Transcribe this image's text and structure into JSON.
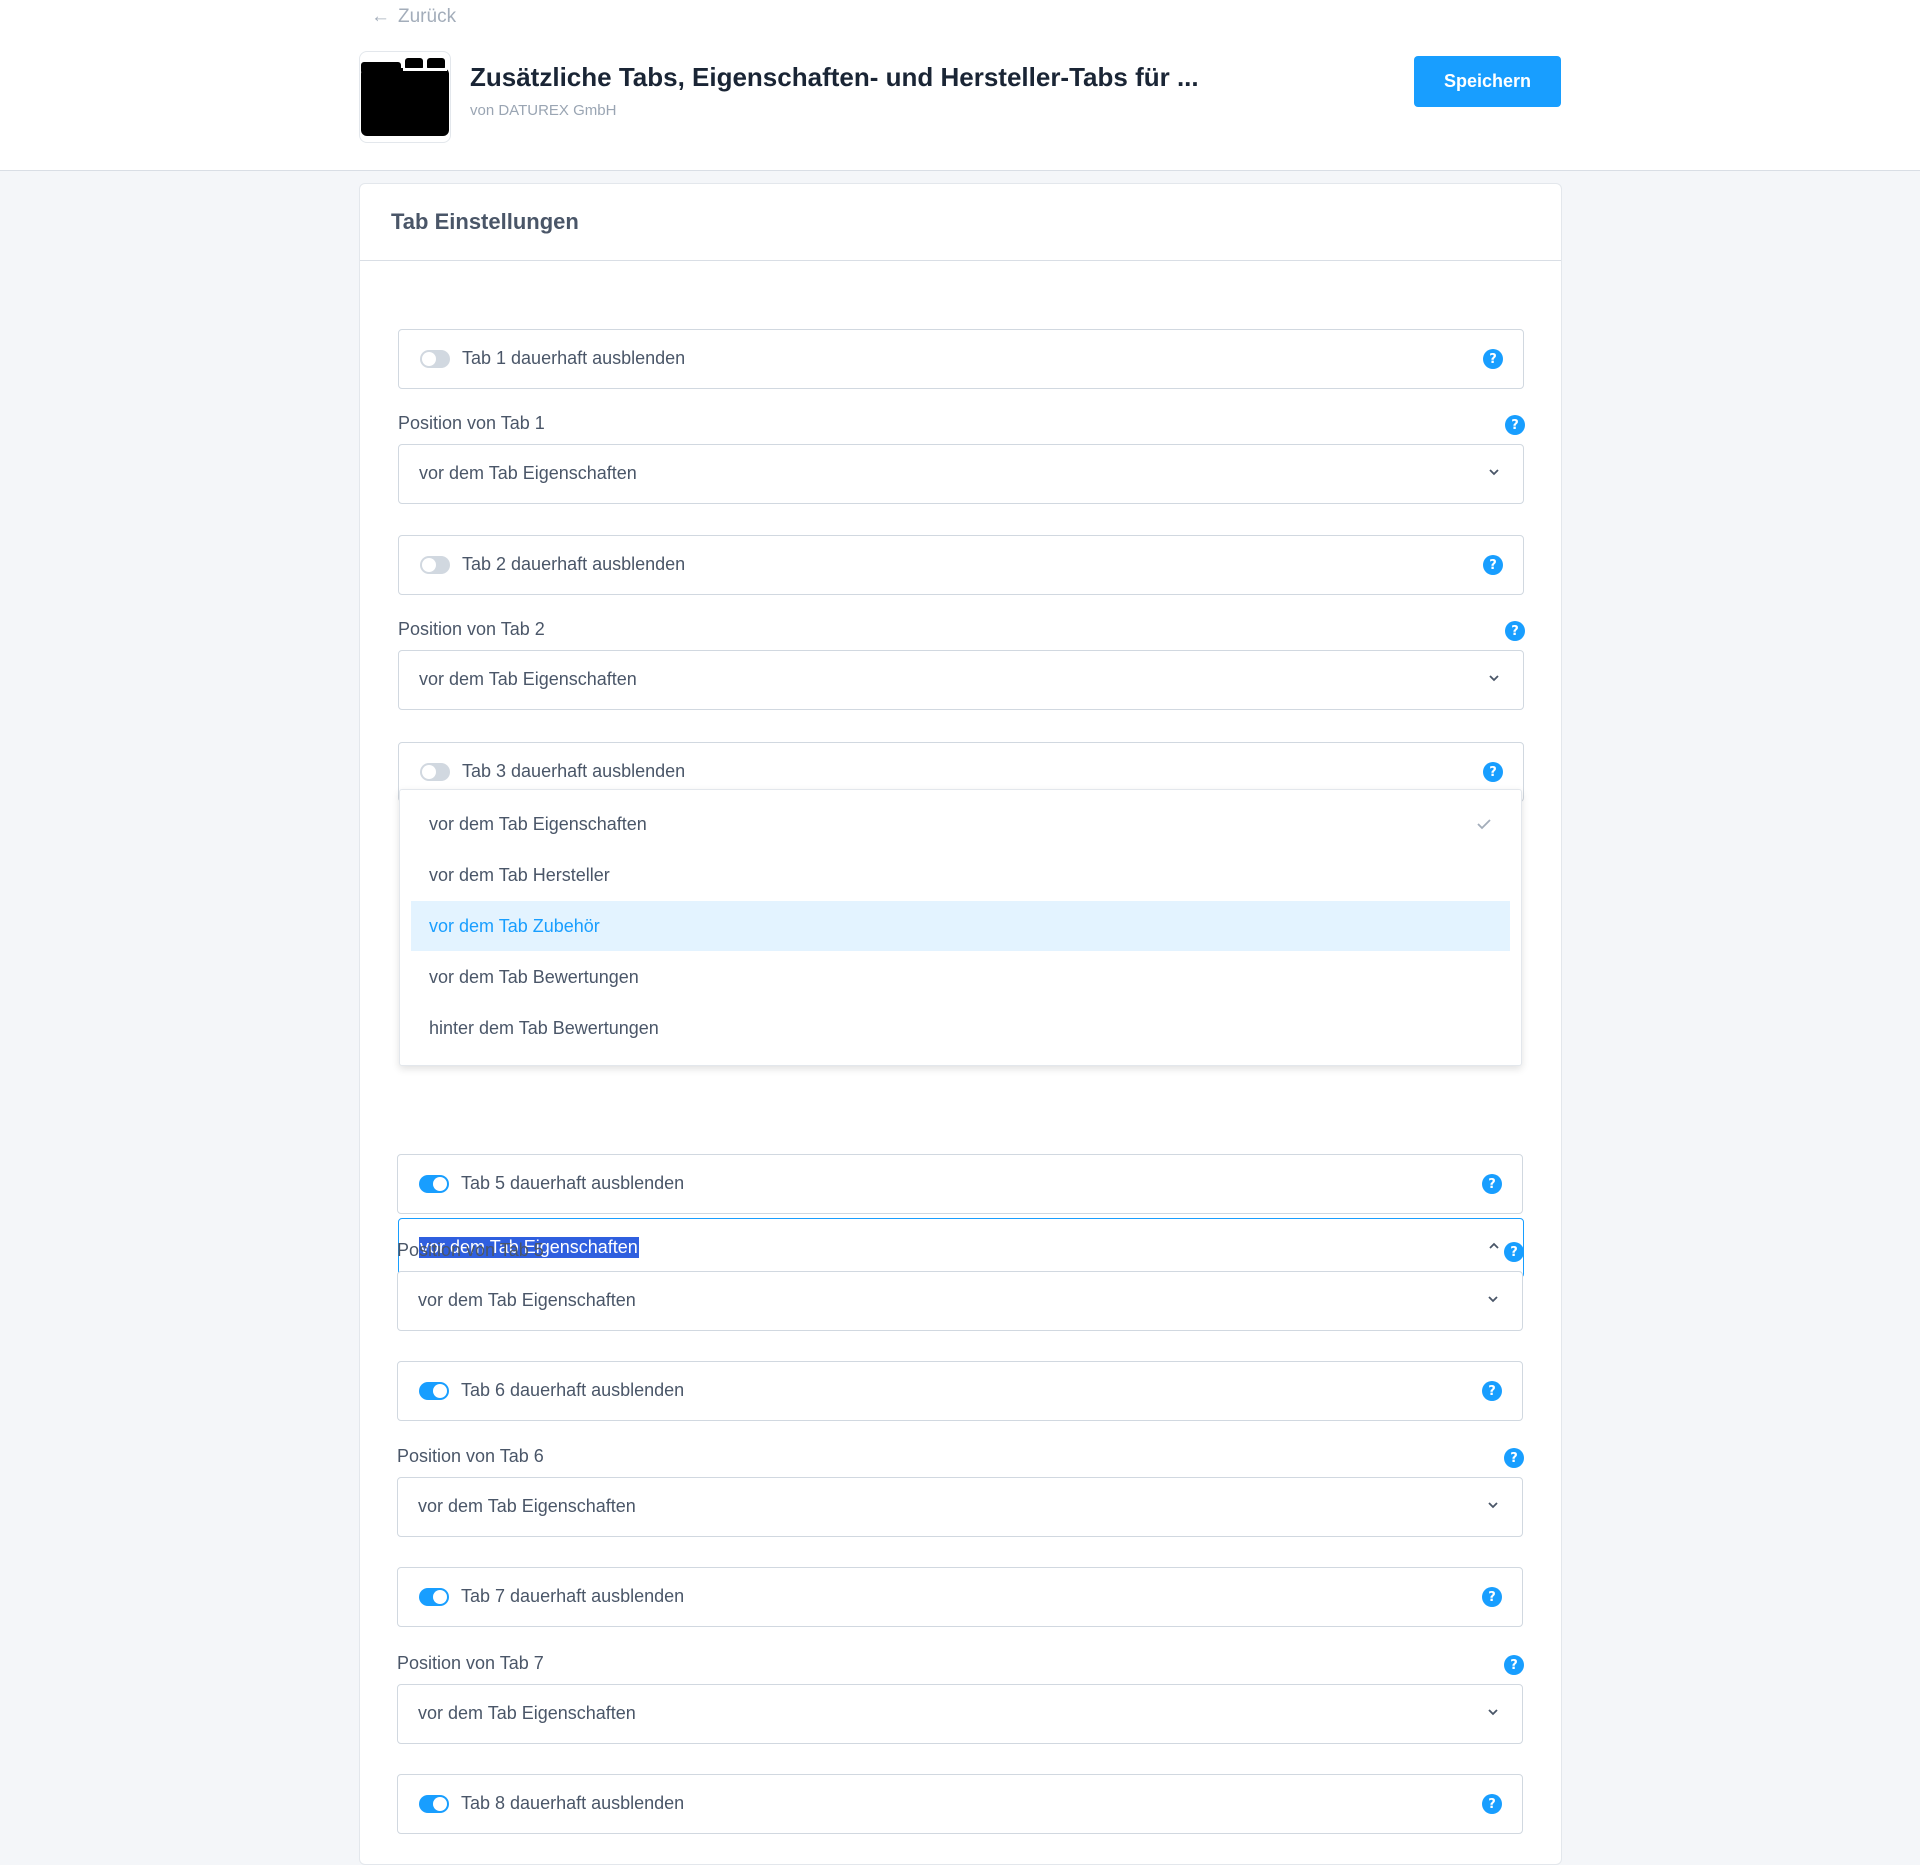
{
  "header": {
    "back_label": "Zurück",
    "app_title": "Zusätzliche Tabs, Eigenschaften- und Hersteller-Tabs für ...",
    "app_vendor": "von DATUREX GmbH",
    "save_label": "Speichern"
  },
  "card": {
    "title": "Tab Einstellungen"
  },
  "tabs": [
    {
      "hide_label": "Tab 1 dauerhaft ausblenden",
      "hidden": false,
      "position_label": "Position von Tab 1",
      "position_value": "vor dem Tab Eigenschaften"
    },
    {
      "hide_label": "Tab 2 dauerhaft ausblenden",
      "hidden": false,
      "position_label": "Position von Tab 2",
      "position_value": "vor dem Tab Eigenschaften"
    },
    {
      "hide_label": "Tab 3 dauerhaft ausblenden",
      "hidden": false
    },
    {
      "position_value": "vor dem Tab Eigenschaften"
    },
    {
      "hide_label": "Tab 5 dauerhaft ausblenden",
      "hidden": true,
      "position_label": "Position von Tab 5",
      "position_value": "vor dem Tab Eigenschaften"
    },
    {
      "hide_label": "Tab 6 dauerhaft ausblenden",
      "hidden": true,
      "position_label": "Position von Tab 6",
      "position_value": "vor dem Tab Eigenschaften"
    },
    {
      "hide_label": "Tab 7 dauerhaft ausblenden",
      "hidden": true,
      "position_label": "Position von Tab 7",
      "position_value": "vor dem Tab Eigenschaften"
    },
    {
      "hide_label": "Tab 8 dauerhaft ausblenden",
      "hidden": true
    }
  ],
  "dropdown": {
    "options": [
      "vor dem Tab Eigenschaften",
      "vor dem Tab Hersteller",
      "vor dem Tab Zubehör",
      "vor dem Tab Bewertungen",
      "hinter dem Tab Bewertungen"
    ],
    "selected": "vor dem Tab Eigenschaften",
    "hovered": "vor dem Tab Zubehör"
  },
  "colors": {
    "accent": "#189eff",
    "toggle_off": "#d1d8e0",
    "text": "#4a5668",
    "hover_bg": "#e3f3ff"
  },
  "icons": {
    "back": "arrow-left-icon",
    "app": "folder-icon",
    "help": "question-icon",
    "select": "chevron-down-icon",
    "select_open": "chevron-up-icon",
    "check": "checkmark-icon"
  }
}
